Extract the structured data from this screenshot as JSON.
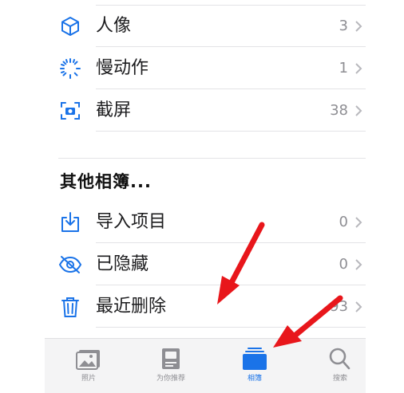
{
  "albums": [
    {
      "label": "人像",
      "count": "3",
      "icon": "cube-icon"
    },
    {
      "label": "慢动作",
      "count": "1",
      "icon": "slow-motion-icon"
    },
    {
      "label": "截屏",
      "count": "38",
      "icon": "screenshot-icon"
    }
  ],
  "other": {
    "title": "其他相簿...",
    "items": [
      {
        "label": "导入项目",
        "count": "0",
        "icon": "import-icon"
      },
      {
        "label": "已隐藏",
        "count": "0",
        "icon": "eye-hidden-icon"
      },
      {
        "label": "最近删除",
        "count": "93",
        "icon": "trash-icon"
      }
    ]
  },
  "tabbar": {
    "tabs": [
      {
        "label": "照片",
        "icon": "photos-icon"
      },
      {
        "label": "为你推荐",
        "icon": "for-you-icon"
      },
      {
        "label": "相簿",
        "icon": "albums-icon"
      },
      {
        "label": "搜索",
        "icon": "search-icon"
      }
    ],
    "active_index": 2
  },
  "colors": {
    "accent": "#1a73e8",
    "arrow": "#e8161b",
    "secondary_text": "#8e8e93"
  }
}
